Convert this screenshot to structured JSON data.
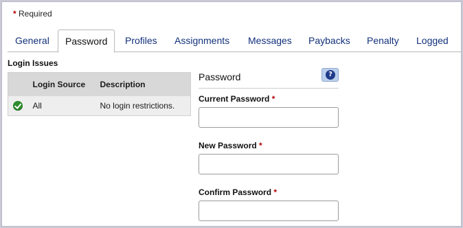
{
  "required_note": {
    "star": "*",
    "text": "Required"
  },
  "tabs": [
    {
      "label": "General",
      "active": false
    },
    {
      "label": "Password",
      "active": true
    },
    {
      "label": "Profiles",
      "active": false
    },
    {
      "label": "Assignments",
      "active": false
    },
    {
      "label": "Messages",
      "active": false
    },
    {
      "label": "Paybacks",
      "active": false
    },
    {
      "label": "Penalty",
      "active": false
    },
    {
      "label": "Logged",
      "active": false
    }
  ],
  "login_issues": {
    "title": "Login Issues",
    "columns": [
      "Login Source",
      "Description"
    ],
    "rows": [
      {
        "status_icon": "check-circle-icon",
        "source": "All",
        "description": "No login restrictions."
      }
    ]
  },
  "password_panel": {
    "title": "Password",
    "help_icon": "question-icon",
    "help_glyph": "?",
    "fields": [
      {
        "label": "Current Password",
        "required_mark": "*",
        "value": ""
      },
      {
        "label": "New Password",
        "required_mark": "*",
        "value": ""
      },
      {
        "label": "Confirm Password",
        "required_mark": "*",
        "value": ""
      }
    ]
  },
  "colors": {
    "tab_text": "#12307a",
    "required": "#b00000",
    "success": "#2e8b2e"
  }
}
